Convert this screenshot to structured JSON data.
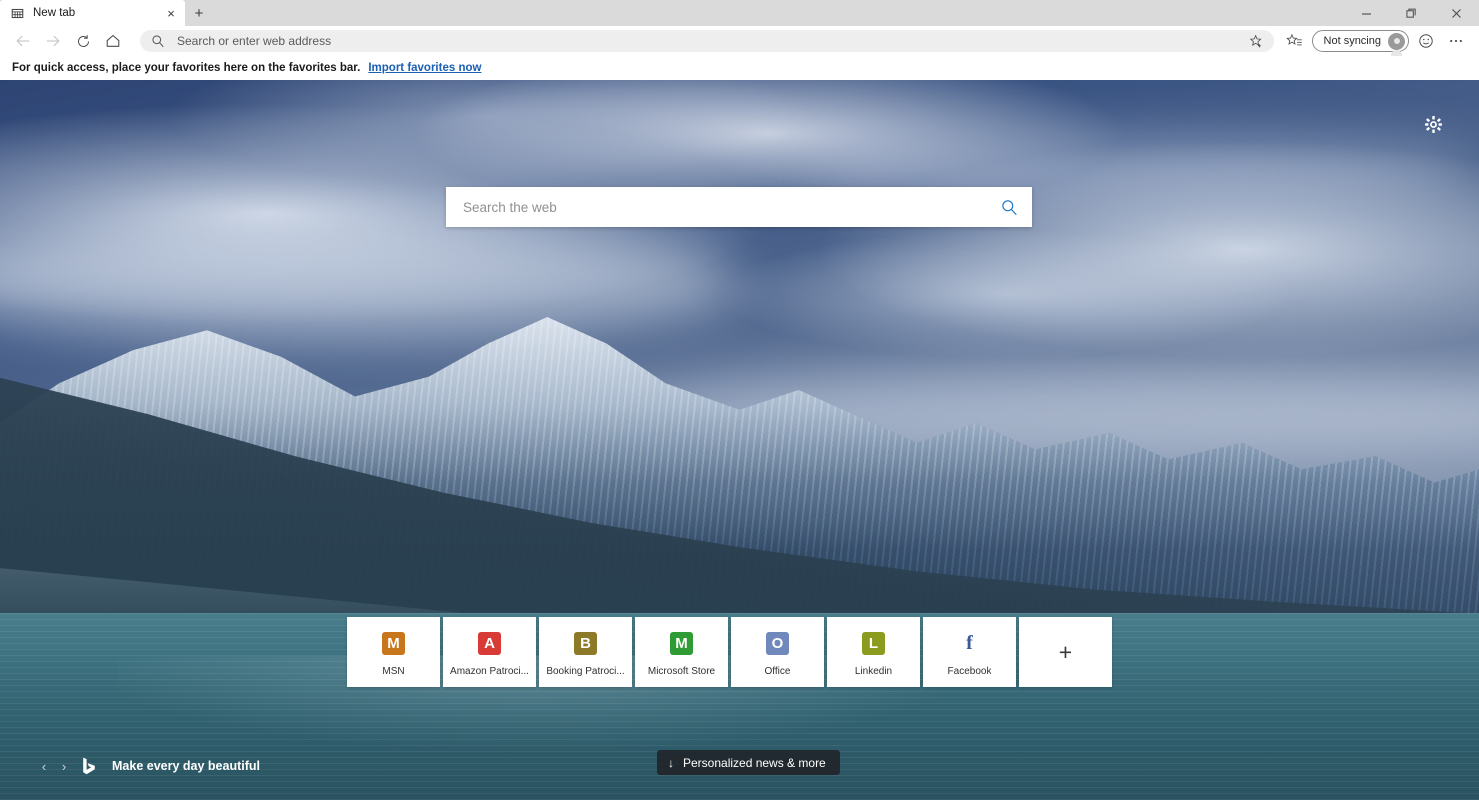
{
  "window": {
    "minimize_label": "Minimize",
    "restore_label": "Restore",
    "close_label": "Close"
  },
  "tabstrip": {
    "tabs": [
      {
        "title": "New tab",
        "favicon": "newtab-grid-icon",
        "close_label": "×"
      }
    ],
    "new_tab_label": "+"
  },
  "toolbar": {
    "back_label": "←",
    "forward_label": "→",
    "refresh_label": "↻",
    "home_label": "Home",
    "address": {
      "value": "",
      "placeholder": "Search or enter web address"
    },
    "favorite_label": "Add this page to favorites",
    "collections_label": "Collections",
    "profile": {
      "label": "Not syncing"
    },
    "feedback_label": "Send feedback",
    "settings_label": "Settings and more"
  },
  "favorites_bar": {
    "message": "For quick access, place your favorites here on the favorites bar.",
    "link": "Import favorites now"
  },
  "page": {
    "settings_gear_label": "Page settings",
    "search": {
      "value": "",
      "placeholder": "Search the web",
      "go_label": "Search"
    },
    "tiles": [
      {
        "label": "MSN",
        "glyph": "M",
        "color": "#c7761b",
        "style": "box"
      },
      {
        "label": "Amazon Patroci...",
        "glyph": "A",
        "color": "#d83b35",
        "style": "box"
      },
      {
        "label": "Booking Patroci...",
        "glyph": "B",
        "color": "#8d7a28",
        "style": "box"
      },
      {
        "label": "Microsoft Store",
        "glyph": "M",
        "color": "#2e9b34",
        "style": "box"
      },
      {
        "label": "Office",
        "glyph": "O",
        "color": "#7188bd",
        "style": "box"
      },
      {
        "label": "Linkedin",
        "glyph": "L",
        "color": "#8b9b1e",
        "style": "box"
      },
      {
        "label": "Facebook",
        "glyph": "f",
        "color": "#3b5998",
        "style": "plain"
      }
    ],
    "add_tile_label": "+",
    "image_caption": {
      "prev_label": "‹",
      "next_label": "›",
      "logo": "bing-logo",
      "text": "Make every day beautiful"
    },
    "news_button": {
      "arrow": "↓",
      "label": "Personalized news & more"
    }
  },
  "colors": {
    "accent": "#1976c8",
    "link": "#1a5fb4",
    "chrome_bg": "#ffffff",
    "tabstrip_bg": "#dadada"
  }
}
